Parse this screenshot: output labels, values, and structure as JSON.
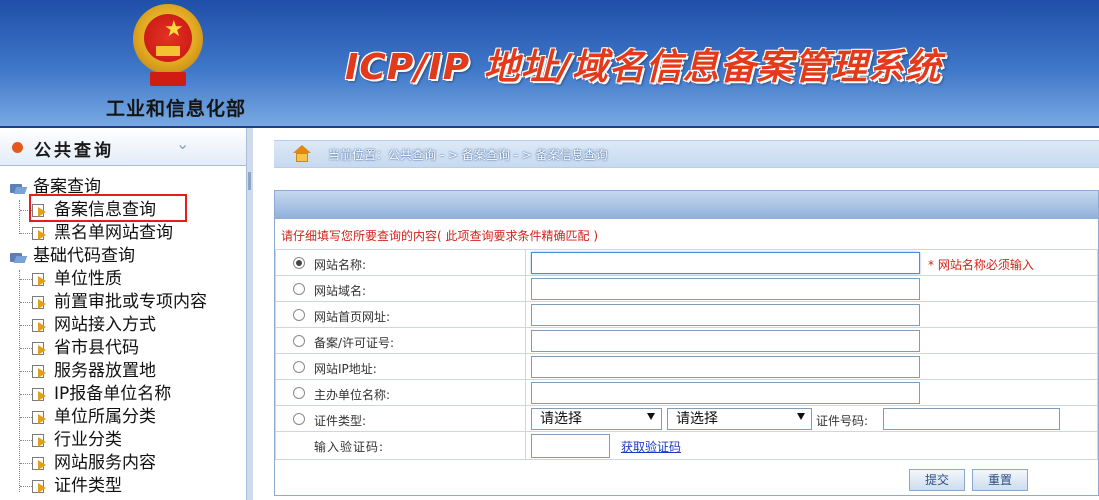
{
  "header": {
    "ministry": "工业和信息化部",
    "system_title": "ICP/IP 地址/域名信息备案管理系统",
    "emblem_icon": "national-emblem-icon",
    "colors": {
      "bg_top": "#1f4fa8",
      "bg_bottom": "#78a9e2",
      "title": "#e33a1c"
    }
  },
  "sidebar": {
    "title": "公共查询",
    "groups": [
      {
        "label": "备案查询",
        "items": [
          "备案信息查询",
          "黑名单网站查询"
        ]
      },
      {
        "label": "基础代码查询",
        "items": [
          "单位性质",
          "前置审批或专项内容",
          "网站接入方式",
          "省市县代码",
          "服务器放置地",
          "IP报备单位名称",
          "单位所属分类",
          "行业分类",
          "网站服务内容",
          "证件类型"
        ]
      }
    ],
    "selected": "备案信息查询"
  },
  "breadcrumb": {
    "text": "当前位置：公共查询  - >  备案查询  - > 备案信息查询"
  },
  "form": {
    "hint": "请仔细填写您所要查询的内容( 此项查询要求条件精确匹配 )",
    "fields": [
      {
        "label": "网站名称:",
        "checked": true
      },
      {
        "label": "网站域名:",
        "checked": false
      },
      {
        "label": "网站首页网址:",
        "checked": false
      },
      {
        "label": "备案/许可证号:",
        "checked": false
      },
      {
        "label": "网站IP地址:",
        "checked": false
      },
      {
        "label": "主办单位名称:",
        "checked": false
      },
      {
        "label": "证件类型:",
        "checked": false
      }
    ],
    "required_note": "* 网站名称必须输入",
    "cert_type_select_1": "请选择",
    "cert_type_select_2": "请选择",
    "cert_no_label": "证件号码:",
    "captcha_label": "输入验证码:",
    "captcha_link": "获取验证码",
    "submit": "提交",
    "reset": "重置",
    "colors": {
      "hint": "#d0241a",
      "link": "#1d39c4"
    }
  }
}
